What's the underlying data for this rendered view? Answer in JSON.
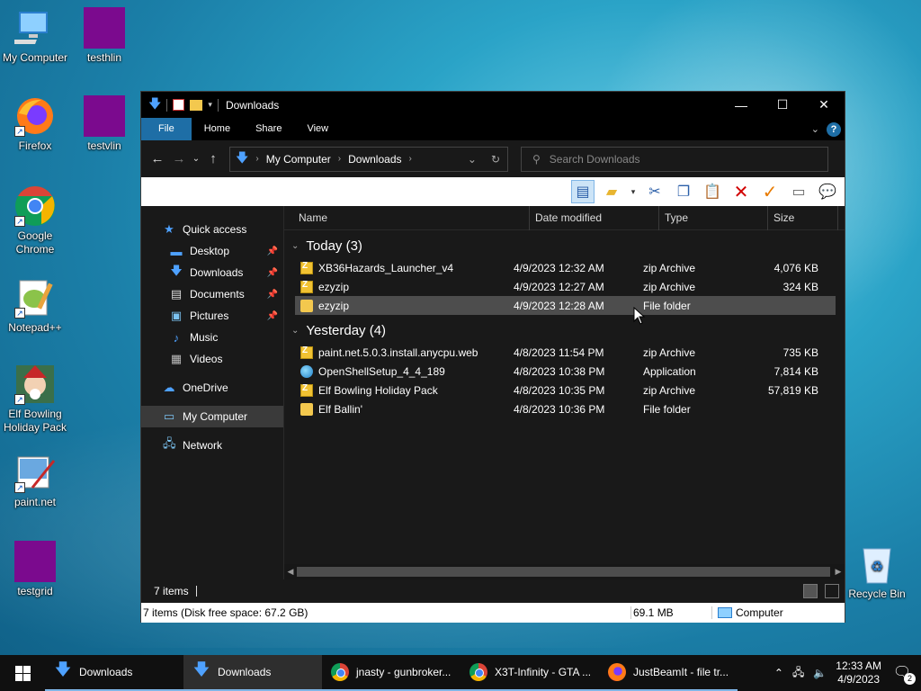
{
  "desktop": {
    "icons": [
      {
        "label": "My Computer"
      },
      {
        "label": "testhlin"
      },
      {
        "label": "Firefox"
      },
      {
        "label": "testvlin"
      },
      {
        "label": "Google Chrome"
      },
      {
        "label": "Notepad++"
      },
      {
        "label": "Elf Bowling Holiday Pack"
      },
      {
        "label": "paint.net"
      },
      {
        "label": "testgrid"
      },
      {
        "label": "Recycle Bin"
      }
    ]
  },
  "window": {
    "title": "Downloads",
    "ribbon_tabs": [
      "File",
      "Home",
      "Share",
      "View"
    ],
    "address": {
      "root": "My Computer",
      "current": "Downloads"
    },
    "search_placeholder": "Search Downloads",
    "nav": {
      "quick_access": "Quick access",
      "items": [
        "Desktop",
        "Downloads",
        "Documents",
        "Pictures",
        "Music",
        "Videos"
      ],
      "onedrive": "OneDrive",
      "my_computer": "My Computer",
      "network": "Network"
    },
    "columns": [
      "Name",
      "Date modified",
      "Type",
      "Size"
    ],
    "groups": [
      {
        "label": "Today (3)",
        "rows": [
          {
            "name": "XB36Hazards_Launcher_v4",
            "date": "4/9/2023 12:32 AM",
            "type": "zip Archive",
            "size": "4,076 KB"
          },
          {
            "name": "ezyzip",
            "date": "4/9/2023 12:27 AM",
            "type": "zip Archive",
            "size": "324 KB"
          },
          {
            "name": "ezyzip",
            "date": "4/9/2023 12:28 AM",
            "type": "File folder",
            "size": ""
          }
        ]
      },
      {
        "label": "Yesterday (4)",
        "rows": [
          {
            "name": "paint.net.5.0.3.install.anycpu.web",
            "date": "4/8/2023 11:54 PM",
            "type": "zip Archive",
            "size": "735 KB"
          },
          {
            "name": "OpenShellSetup_4_4_189",
            "date": "4/8/2023 10:38 PM",
            "type": "Application",
            "size": "7,814 KB"
          },
          {
            "name": "Elf Bowling Holiday Pack",
            "date": "4/8/2023 10:35 PM",
            "type": "zip Archive",
            "size": "57,819 KB"
          },
          {
            "name": "Elf Ballin'",
            "date": "4/8/2023 10:36 PM",
            "type": "File folder",
            "size": ""
          }
        ]
      }
    ],
    "status_items": "7 items",
    "detail": {
      "left": "7 items (Disk free space: 67.2 GB)",
      "size": "69.1 MB",
      "location": "Computer"
    }
  },
  "taskbar": {
    "buttons": [
      {
        "label": "Downloads"
      },
      {
        "label": "Downloads"
      },
      {
        "label": "jnasty - gunbroker..."
      },
      {
        "label": "X3T-Infinity - GTA ..."
      },
      {
        "label": "JustBeamIt - file tr..."
      }
    ],
    "time": "12:33 AM",
    "date": "4/9/2023",
    "notifications": "2"
  }
}
